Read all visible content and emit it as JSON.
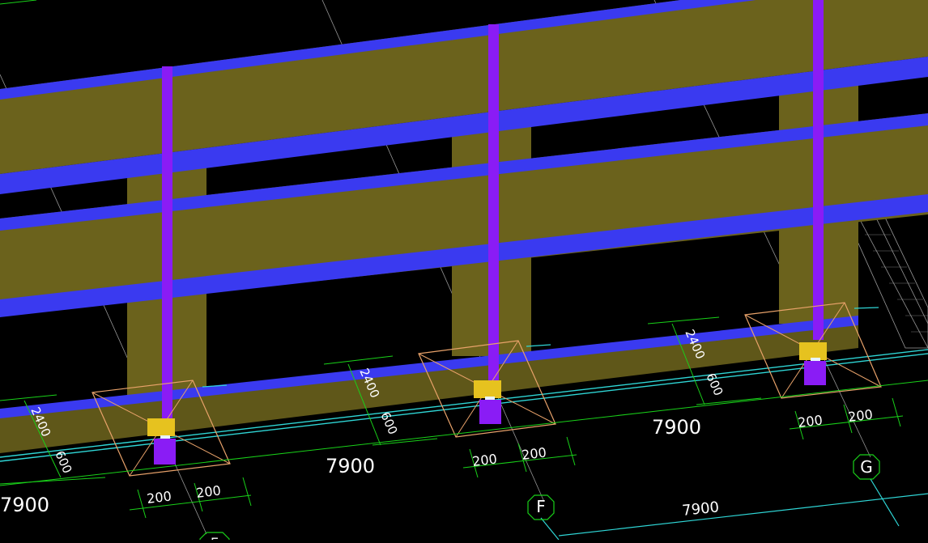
{
  "colors": {
    "background": "#000000",
    "beam_olive": "#6b621c",
    "beam_olive_dark": "#5a5218",
    "beam_blue": "#3a3af0",
    "column_purple": "#8a1cf5",
    "dimension_green": "#19d119",
    "axis_cyan": "#2fd6d6",
    "grid_line": "#c8c8c8",
    "foundation_orange": "#e8a26a",
    "pile_yellow": "#e6c21f",
    "text_white": "#ffffff"
  },
  "dimensions": {
    "span_labels": [
      "7900",
      "7900",
      "7900"
    ],
    "bottom_span_label": "7900",
    "offset_label": "2400",
    "small_offset_label": "600",
    "cap_half_label": "200"
  },
  "axis_bubbles": {
    "F": "F",
    "G": "G",
    "E": "E"
  },
  "icons": {
    "axis_bubble": "octagon-axis-marker"
  }
}
